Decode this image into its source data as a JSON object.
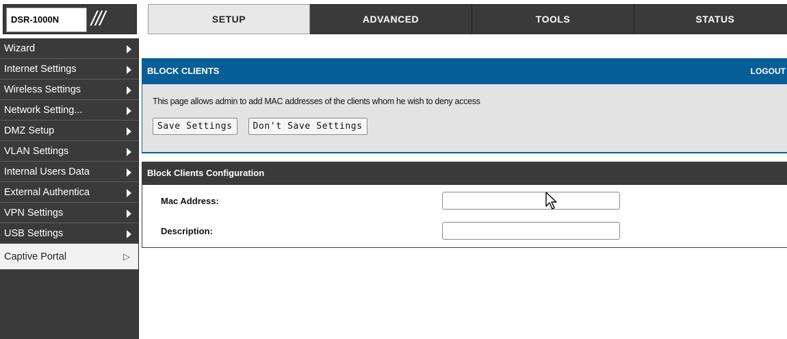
{
  "header": {
    "model": "DSR-1000N",
    "slashes": "///",
    "tabs": [
      {
        "label": "SETUP",
        "active": true
      },
      {
        "label": "ADVANCED",
        "active": false
      },
      {
        "label": "TOOLS",
        "active": false
      },
      {
        "label": "STATUS",
        "active": false
      }
    ]
  },
  "sidebar": {
    "items": [
      {
        "label": "Wizard"
      },
      {
        "label": "Internet Settings"
      },
      {
        "label": "Wireless Settings"
      },
      {
        "label": "Network Setting..."
      },
      {
        "label": "DMZ Setup"
      },
      {
        "label": "VLAN Settings"
      },
      {
        "label": "Internal Users Data"
      },
      {
        "label": "External Authentica"
      },
      {
        "label": "VPN Settings"
      },
      {
        "label": "USB Settings"
      },
      {
        "label": "Captive Portal",
        "selected": true
      }
    ]
  },
  "page": {
    "title": "BLOCK CLIENTS",
    "logout": "LOGOUT",
    "intro": "This page allows admin to add MAC addresses of the clients whom he wish to deny access",
    "save_button": "Save Settings",
    "dont_save_button": "Don't Save Settings",
    "config_title": "Block Clients Configuration",
    "fields": {
      "mac_label": "Mac Address:",
      "mac_value": "",
      "description_label": "Description:",
      "description_value": ""
    }
  },
  "colors": {
    "header_blue": "#075f97",
    "dark_gray": "#3a3a3a",
    "panel_gray": "#e3e3e3"
  }
}
